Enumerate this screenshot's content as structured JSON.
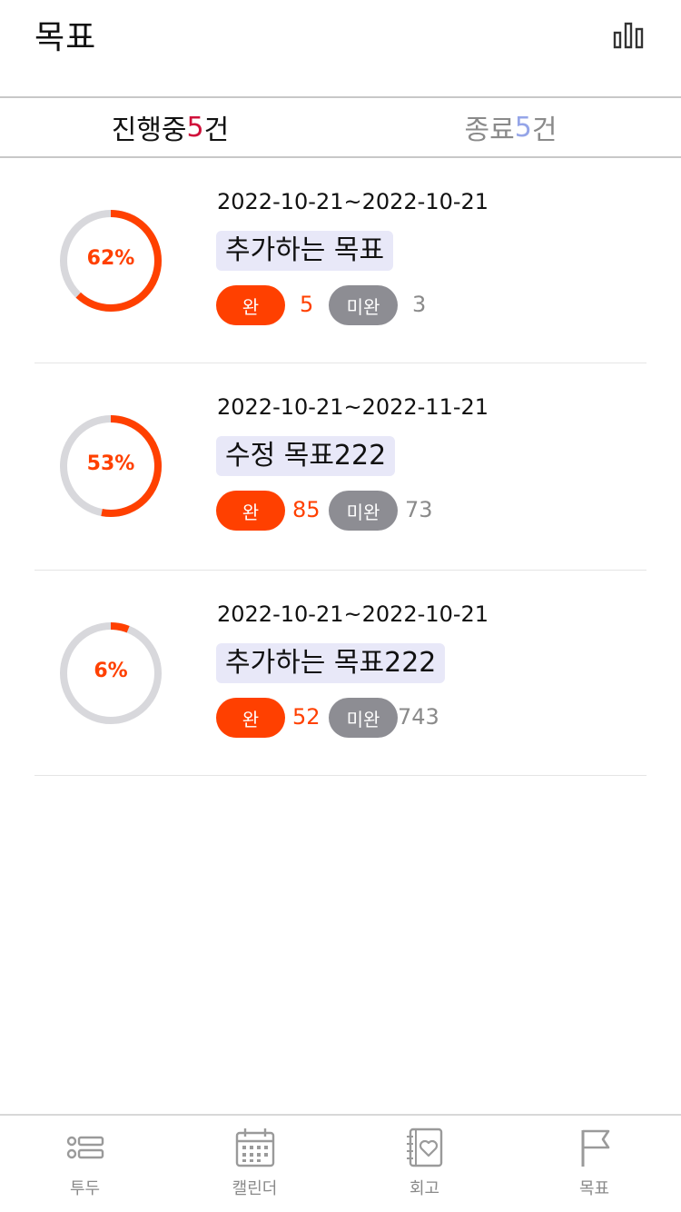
{
  "header": {
    "title": "목표",
    "stats_icon": "bar-chart-icon"
  },
  "tabs": [
    {
      "label": "진행중 ",
      "count": "5",
      "unit": "건"
    },
    {
      "label": "종료 ",
      "count": "5",
      "unit": "건"
    }
  ],
  "goals": [
    {
      "date_range": "2022-10-21~2022-10-21",
      "name": "추가하는 목표",
      "progress": 0.62,
      "progress_label": "62%",
      "done_label": "완",
      "done_count": "5",
      "undone_label": "미완",
      "undone_count": "3"
    },
    {
      "date_range": "2022-10-21~2022-11-21",
      "name": "수정 목표222",
      "progress": 0.53,
      "progress_label": "53%",
      "done_label": "완",
      "done_count": "85",
      "undone_label": "미완",
      "undone_count": "73"
    },
    {
      "date_range": "2022-10-21~2022-10-21",
      "name": "추가하는 목표222",
      "progress": 0.06,
      "progress_label": "6%",
      "done_label": "완",
      "done_count": "52",
      "undone_label": "미완",
      "undone_count": "743"
    }
  ],
  "nav": [
    {
      "label": "투두",
      "icon": "todo-list-icon"
    },
    {
      "label": "캘린더",
      "icon": "calendar-icon"
    },
    {
      "label": "회고",
      "icon": "journal-heart-icon"
    },
    {
      "label": "목표",
      "icon": "flag-icon"
    }
  ],
  "colors": {
    "accent": "#ff4000",
    "track": "#d8d8dc",
    "tab_count_active": "#d0103a",
    "tab_count_done": "#95a5e8"
  }
}
